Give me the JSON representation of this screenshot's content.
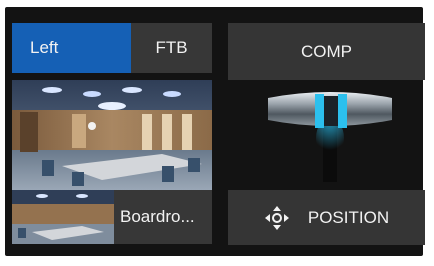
{
  "transition_panel": {
    "left_label": "Left",
    "ftb_label": "FTB",
    "comp_label": "COMP",
    "position_label": "POSITION",
    "source_name": "Boardro...",
    "accent_color": "#1560b5",
    "tbar_indicator_color": "#2cc0ee",
    "position_icon": "move-arrows-icon"
  }
}
